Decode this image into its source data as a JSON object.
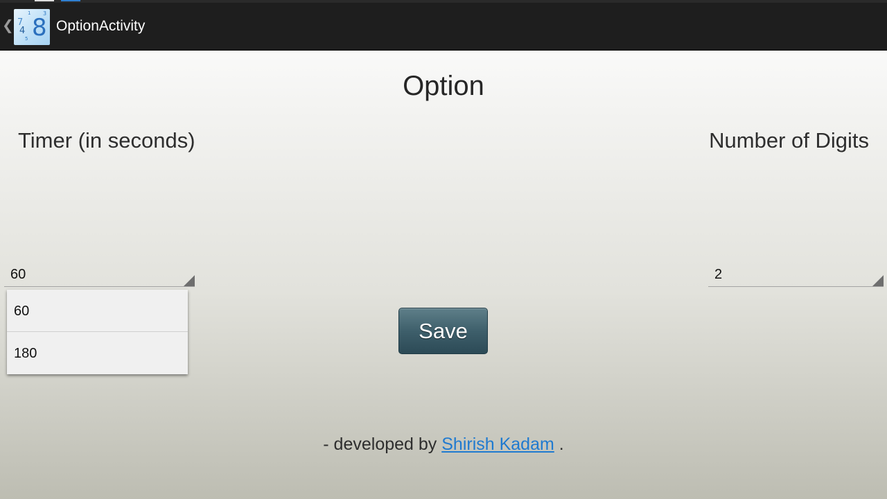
{
  "action_bar": {
    "title": "OptionActivity",
    "app_icon": {
      "name": "number-tiles-icon",
      "digits": [
        "7",
        "4",
        "1",
        "5",
        "3",
        "8"
      ],
      "background": "#bfe0f7",
      "digit_color": "#2a6fbd"
    },
    "up_icon": "chevron-left-icon",
    "up_glyph": "❮"
  },
  "page": {
    "heading": "Option"
  },
  "timer": {
    "label": "Timer (in seconds)",
    "selected": "60",
    "options": [
      "60",
      "180"
    ]
  },
  "digits": {
    "label": "Number of Digits",
    "selected": "2"
  },
  "save_button": {
    "label": "Save"
  },
  "credit": {
    "prefix": "- developed by ",
    "author": "Shirish Kadam",
    "suffix": " ."
  },
  "colors": {
    "action_bar": "#1e1e1e",
    "save_button": "#3e5f6b",
    "link": "#1f7ad0"
  }
}
